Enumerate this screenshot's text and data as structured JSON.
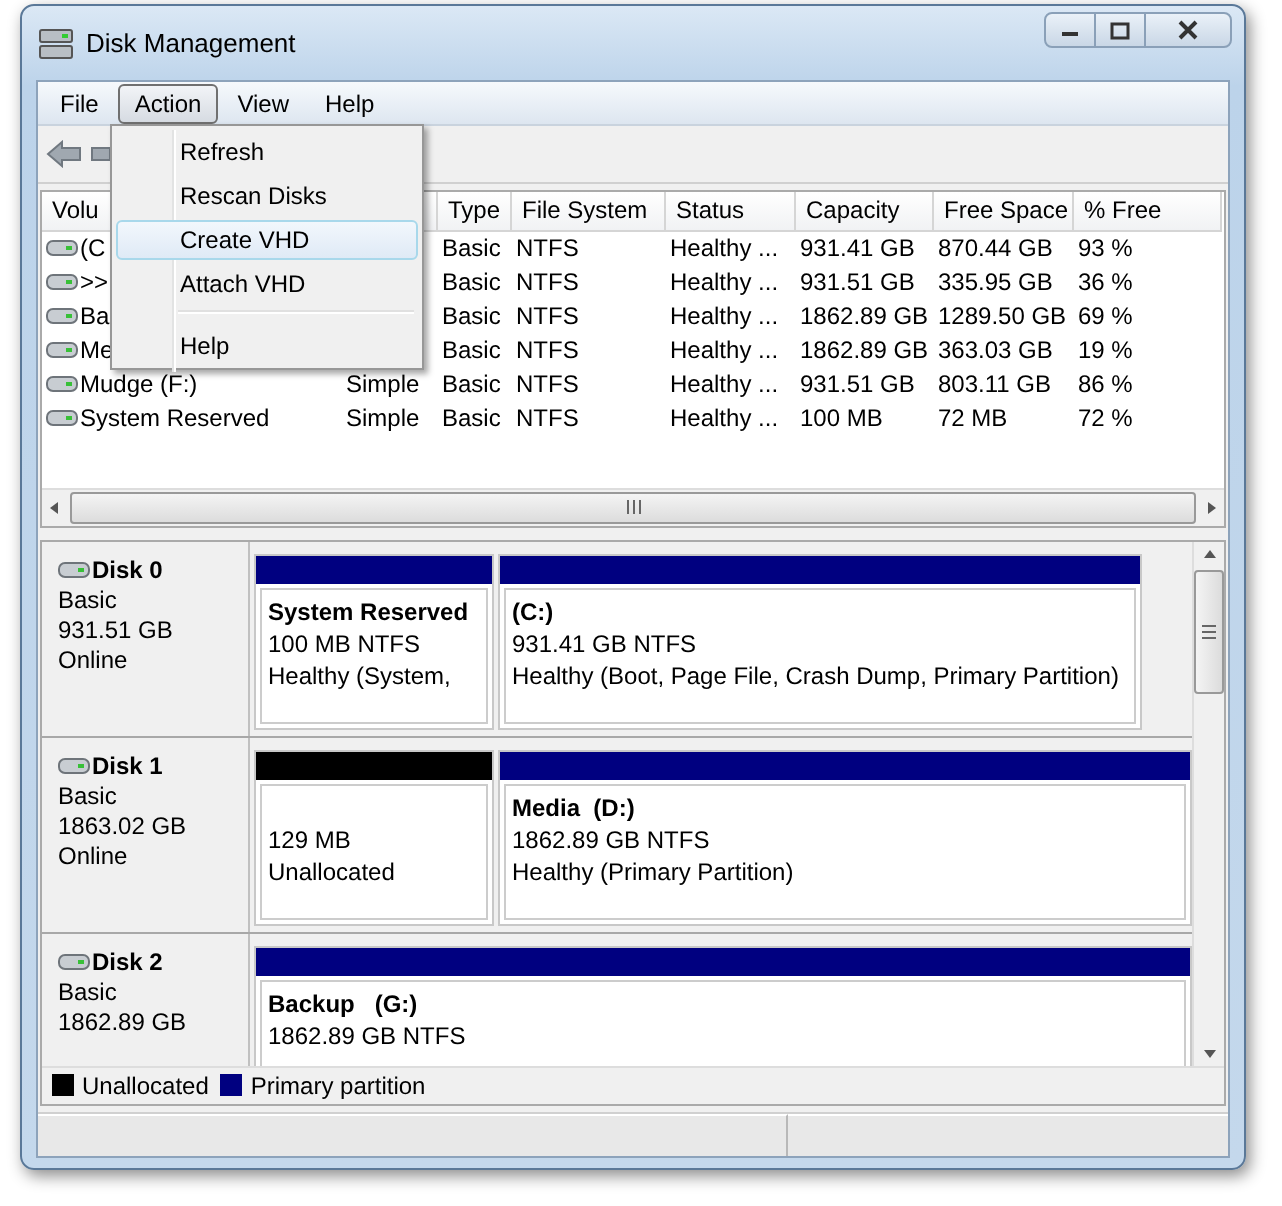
{
  "window": {
    "title": "Disk Management"
  },
  "menu_bar": [
    {
      "label": "File",
      "selected": false
    },
    {
      "label": "Action",
      "selected": true
    },
    {
      "label": "View",
      "selected": false
    },
    {
      "label": "Help",
      "selected": false
    }
  ],
  "action_menu": [
    {
      "kind": "item",
      "label": "Refresh",
      "selected": false
    },
    {
      "kind": "item",
      "label": "Rescan Disks",
      "selected": false
    },
    {
      "kind": "item",
      "label": "Create VHD",
      "selected": true
    },
    {
      "kind": "item",
      "label": "Attach VHD",
      "selected": false
    },
    {
      "kind": "separator"
    },
    {
      "kind": "item",
      "label": "Help",
      "selected": false
    }
  ],
  "volume_table": {
    "columns": [
      "Volu",
      null,
      "Type",
      "File System",
      "Status",
      "Capacity",
      "Free Space",
      "% Free"
    ],
    "rows": [
      [
        "(C",
        null,
        "Basic",
        "NTFS",
        "Healthy ...",
        "931.41 GB",
        "870.44 GB",
        "93 %"
      ],
      [
        ">>",
        null,
        "Basic",
        "NTFS",
        "Healthy ...",
        "931.51 GB",
        "335.95 GB",
        "36 %"
      ],
      [
        "Ba",
        null,
        "Basic",
        "NTFS",
        "Healthy ...",
        "1862.89 GB",
        "1289.50 GB",
        "69 %"
      ],
      [
        "Me",
        null,
        "Basic",
        "NTFS",
        "Healthy ...",
        "1862.89 GB",
        "363.03 GB",
        "19 %"
      ],
      [
        "Mudge (F:)",
        "Simple",
        "Basic",
        "NTFS",
        "Healthy ...",
        "931.51 GB",
        "803.11 GB",
        "86 %"
      ],
      [
        "System Reserved",
        "Simple",
        "Basic",
        "NTFS",
        "Healthy ...",
        "100 MB",
        "72 MB",
        "72 %"
      ]
    ]
  },
  "disks": [
    {
      "name": "Disk 0",
      "type": "Basic",
      "size": "931.51 GB",
      "status": "Online",
      "partitions": [
        {
          "kind": "primary",
          "name": "System Reserved",
          "size": "100 MB NTFS",
          "status": "Healthy (System,"
        },
        {
          "kind": "primary",
          "name": "(C:)",
          "size": "931.41 GB NTFS",
          "status": "Healthy (Boot, Page File, Crash Dump, Primary Partition)"
        }
      ]
    },
    {
      "name": "Disk 1",
      "type": "Basic",
      "size": "1863.02 GB",
      "status": "Online",
      "partitions": [
        {
          "kind": "unallocated",
          "size": "129 MB",
          "status": "Unallocated"
        },
        {
          "kind": "primary",
          "name": "Media  (D:)",
          "size": "1862.89 GB NTFS",
          "status": "Healthy (Primary Partition)"
        }
      ]
    },
    {
      "name": "Disk 2",
      "type": "Basic",
      "size": "1862.89 GB",
      "partitions": [
        {
          "kind": "primary",
          "name": "Backup   (G:)",
          "size": "1862.89 GB NTFS"
        }
      ]
    }
  ],
  "legend": [
    {
      "label": "Unallocated",
      "color": "#000000"
    },
    {
      "label": "Primary partition",
      "color": "#000080"
    }
  ]
}
